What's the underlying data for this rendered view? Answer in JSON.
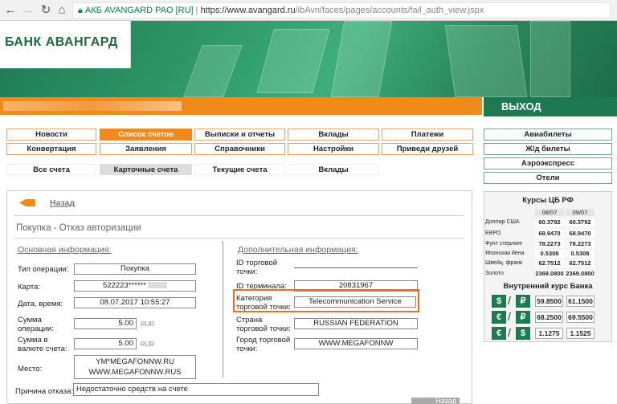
{
  "browser": {
    "secure_label": "АКБ AVANGARD PAO [RU]",
    "url_host": "https://www.avangard.ru",
    "url_path": "/ibAvn/faces/pages/accounts/fail_auth_view.jspx"
  },
  "header": {
    "logo": "БАНК АВАНГАРД",
    "exit_label": "ВЫХОД"
  },
  "nav_row1": [
    "Новости",
    "Список счетов",
    "Выписки и отчеты",
    "Вклады",
    "Платежи"
  ],
  "nav_row2": [
    "Конвертация",
    "Заявления",
    "Справочники",
    "Настройки",
    "Приведи друзей"
  ],
  "sub_tabs": [
    "Все счета",
    "Карточные счета",
    "Текущие счета",
    "Вклады"
  ],
  "right_menu": [
    "Авиабилеты",
    "Ж/д билеты",
    "Аэроэкспресс",
    "Отели"
  ],
  "page": {
    "back_label": "Назад",
    "title": "Покупка - Отказ авторизации",
    "main_section": "Основная информация:",
    "extra_section": "Дополнительная информация:",
    "reason_label": "Причина отказа:",
    "reason_value": "Недостаточно средств на счете",
    "next_label": "Назад"
  },
  "main_fields": {
    "op_type_label": "Тип операции:",
    "op_type_value": "Покупка",
    "card_label": "Карта:",
    "card_value": "522223******",
    "date_label": "Дата, время:",
    "date_value": "08.07.2017 10:55:27",
    "sum_op_label": "Сумма операции:",
    "sum_op_value": "5.00",
    "sum_op_unit": "RUR",
    "sum_acc_label": "Сумма в валюте счета:",
    "sum_acc_value": "5.00",
    "sum_acc_unit": "RUR",
    "place_label": "Место:",
    "place_line1": "YM*MEGAFONNW.RU",
    "place_line2": "WWW.MEGAFONNW.RUS"
  },
  "extra_fields": {
    "pos_id_label": "ID торговой точки:",
    "pos_id_value": "",
    "terminal_label": "ID терминала:",
    "terminal_value": "20831967",
    "category_label": "Категория торговой точки:",
    "category_value": "Telecommunication Service",
    "country_label": "Страна торговой точки:",
    "country_value": "RUSSIAN FEDERATION",
    "city_label": "Город торговой точки:",
    "city_value": "WWW.MEGAFONNW"
  },
  "rates": {
    "title": "Курсы ЦБ РФ",
    "col1": "08/07",
    "col2": "09/07",
    "rows": [
      {
        "name": "Доллар США",
        "v1": "60.3792",
        "v2": "60.3792"
      },
      {
        "name": "ЕВРО",
        "v1": "68.9470",
        "v2": "68.9470"
      },
      {
        "name": "Фунт стерлинг",
        "v1": "78.2273",
        "v2": "78.2273"
      },
      {
        "name": "Японская йена",
        "v1": "0.5308",
        "v2": "0.5308"
      },
      {
        "name": "Швейц. франк",
        "v1": "62.7512",
        "v2": "62.7512"
      },
      {
        "name": "Золото",
        "v1": "2369.0800",
        "v2": "2369.0800"
      }
    ],
    "internal_title": "Внутренний курс Банка",
    "internal": [
      {
        "cur": "$",
        "buy": "59.8500",
        "sell": "61.1500"
      },
      {
        "cur": "€",
        "buy": "68.2500",
        "sell": "69.5500"
      },
      {
        "cur": "€",
        "buy": "1.1275",
        "sell": "1.1525"
      }
    ]
  },
  "colors": {
    "orange": "#f08a1c",
    "green": "#1d7a50",
    "highlight": "#f06a1a"
  }
}
